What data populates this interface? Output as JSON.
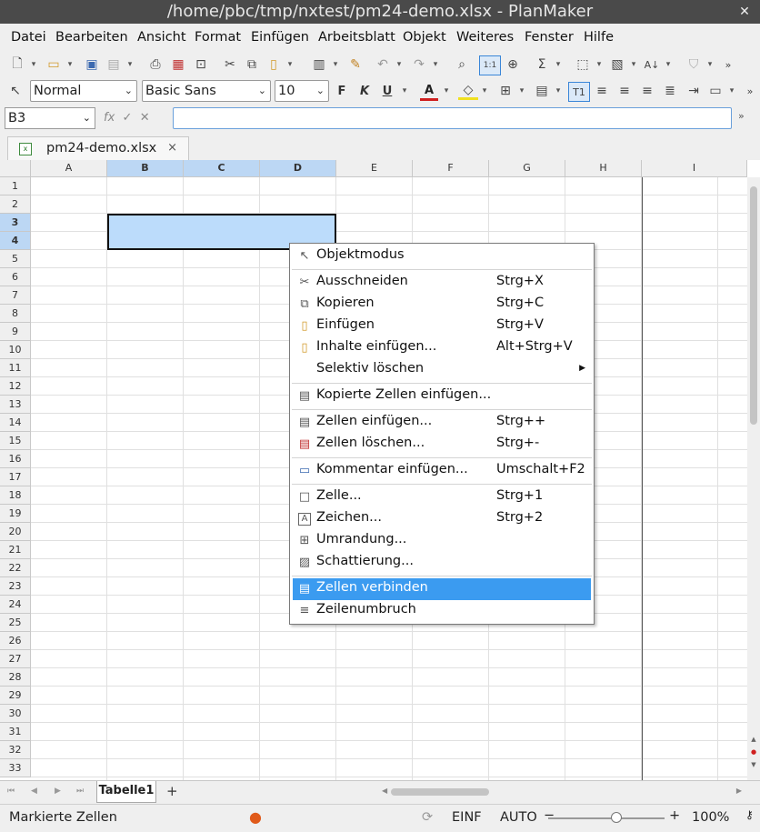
{
  "window": {
    "title": "/home/pbc/tmp/nxtest/pm24-demo.xlsx - PlanMaker",
    "close": "✕"
  },
  "menubar": [
    "Datei",
    "Bearbeiten",
    "Ansicht",
    "Format",
    "Einfügen",
    "Arbeitsblatt",
    "Objekt",
    "Weiteres",
    "Fenster",
    "Hilfe"
  ],
  "format_toolbar": {
    "style": "Normal",
    "font": "Basic Sans",
    "size": "10",
    "bold": "F",
    "italic": "K",
    "underline": "U",
    "text_color_icon": "A"
  },
  "formula_bar": {
    "cell_ref": "B3",
    "fx": "fx",
    "value": ""
  },
  "document_tab": {
    "name": "pm24-demo.xlsx",
    "close": "×"
  },
  "grid": {
    "columns": [
      "A",
      "B",
      "C",
      "D",
      "E",
      "F",
      "G",
      "H",
      "I"
    ],
    "selected_columns": [
      "B",
      "C",
      "D"
    ],
    "rows": [
      "1",
      "2",
      "3",
      "4",
      "5",
      "6",
      "7",
      "8",
      "9",
      "10",
      "11",
      "12",
      "13",
      "14",
      "15",
      "16",
      "17",
      "18",
      "19",
      "20",
      "21",
      "22",
      "23",
      "24",
      "25",
      "26",
      "27",
      "28",
      "29",
      "30",
      "31",
      "32",
      "33"
    ],
    "selected_rows": [
      "3",
      "4"
    ],
    "selection": "B3:D4"
  },
  "context_menu": {
    "items": [
      {
        "label": "Objektmodus",
        "shortcut": "",
        "icon": "pointer-icon"
      },
      {
        "label": "Ausschneiden",
        "shortcut": "Strg+X",
        "icon": "scissors-icon"
      },
      {
        "label": "Kopieren",
        "shortcut": "Strg+C",
        "icon": "copy-icon"
      },
      {
        "label": "Einfügen",
        "shortcut": "Strg+V",
        "icon": "paste-icon"
      },
      {
        "label": "Inhalte einfügen...",
        "shortcut": "Alt+Strg+V",
        "icon": "paste-special-icon"
      },
      {
        "label": "Selektiv löschen",
        "shortcut": "",
        "icon": ""
      },
      {
        "label": "Kopierte Zellen einfügen...",
        "shortcut": "",
        "icon": "insert-copied-cells-icon"
      },
      {
        "label": "Zellen einfügen...",
        "shortcut": "Strg++",
        "icon": "insert-cells-icon"
      },
      {
        "label": "Zellen löschen...",
        "shortcut": "Strg+-",
        "icon": "delete-cells-icon"
      },
      {
        "label": "Kommentar einfügen...",
        "shortcut": "Umschalt+F2",
        "icon": "comment-icon"
      },
      {
        "label": "Zelle...",
        "shortcut": "Strg+1",
        "icon": "cell-format-icon"
      },
      {
        "label": "Zeichen...",
        "shortcut": "Strg+2",
        "icon": "character-icon"
      },
      {
        "label": "Umrandung...",
        "shortcut": "",
        "icon": "border-icon"
      },
      {
        "label": "Schattierung...",
        "shortcut": "",
        "icon": "shading-icon"
      },
      {
        "label": "Zellen verbinden",
        "shortcut": "",
        "icon": "merge-cells-icon"
      },
      {
        "label": "Zeilenumbruch",
        "shortcut": "",
        "icon": "wrap-icon"
      }
    ],
    "highlighted": "Zellen verbinden",
    "highlight_color": "#3b9bf0"
  },
  "sheet_tabs": {
    "active": "Tabelle1",
    "add": "+"
  },
  "statusbar": {
    "left": "Markierte Zellen",
    "mode": "EINF",
    "calc": "AUTO",
    "zoom_minus": "−",
    "zoom_plus": "+",
    "zoom": "100%"
  },
  "colors": {
    "selection_fill": "#bcdcfb",
    "header_selected": "#bcd7f4",
    "titlebar": "#4a4a4a"
  }
}
